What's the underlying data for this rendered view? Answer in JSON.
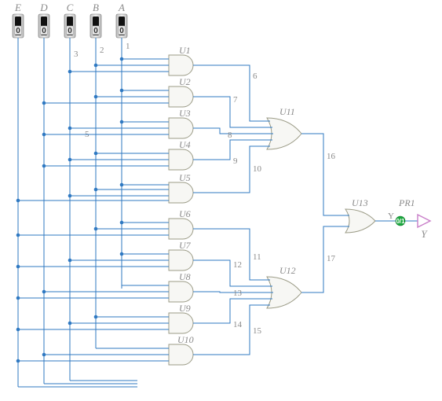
{
  "inputs": {
    "E": {
      "label": "E",
      "value": "0"
    },
    "D": {
      "label": "D",
      "value": "0"
    },
    "C": {
      "label": "C",
      "value": "0"
    },
    "B": {
      "label": "B",
      "value": "0"
    },
    "A": {
      "label": "A",
      "value": "0"
    }
  },
  "gates": {
    "U1": "U1",
    "U2": "U2",
    "U3": "U3",
    "U4": "U4",
    "U5": "U5",
    "U6": "U6",
    "U7": "U7",
    "U8": "U8",
    "U9": "U9",
    "U10": "U10",
    "U11": "U11",
    "U12": "U12",
    "U13": "U13"
  },
  "nets": {
    "n1": "1",
    "n2": "2",
    "n3": "3",
    "n5": "5",
    "n6": "6",
    "n7": "7",
    "n8": "8",
    "n9": "9",
    "n10": "10",
    "n11": "11",
    "n12": "12",
    "n13": "13",
    "n14": "14",
    "n15": "15",
    "n16": "16",
    "n17": "17"
  },
  "output": {
    "probe_label": "PR1",
    "probe_value": "0/1",
    "pin_label": "Y",
    "name": "Y"
  }
}
